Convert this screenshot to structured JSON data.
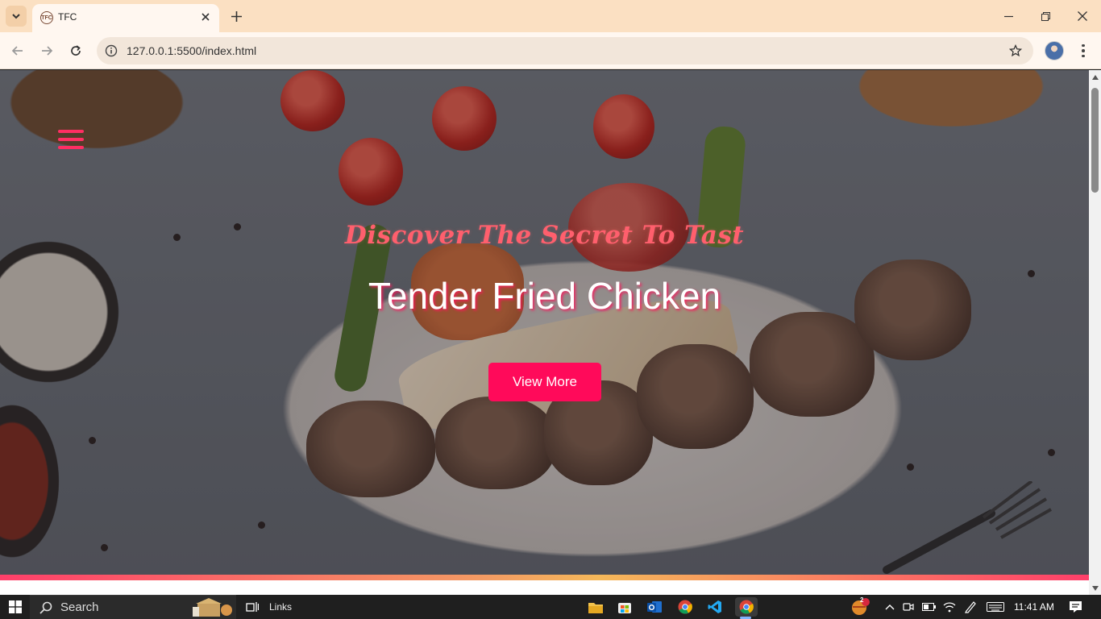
{
  "browser": {
    "tab_title": "TFC",
    "tab_favicon_text": "TFC",
    "url": "127.0.0.1:5500/index.html"
  },
  "page": {
    "tagline": "Discover The Secret To Tast",
    "headline": "Tender Fried Chicken",
    "cta_label": "View More",
    "accent_color": "#ff0a5a",
    "tagline_color": "#ff5f6d"
  },
  "taskbar": {
    "search_label": "Search",
    "links_label": "Links",
    "time": "11:41 AM",
    "notification_count": "2"
  }
}
